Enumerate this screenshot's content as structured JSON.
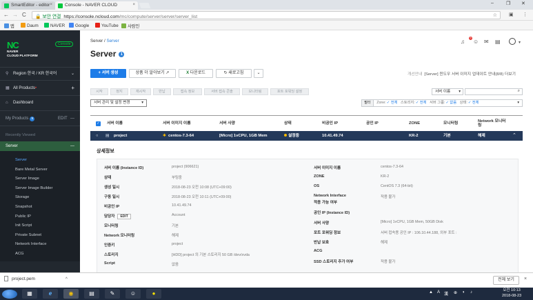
{
  "browser": {
    "tabs": [
      {
        "label": "SmartEditor - editor",
        "close": "×"
      },
      {
        "label": "Console - NAVER CLOUD",
        "close": "×"
      }
    ],
    "window_controls": [
      "–",
      "❐",
      "✕"
    ],
    "nav": {
      "back": "←",
      "forward": "→",
      "reload": "C"
    },
    "address": {
      "lock": "🔒",
      "secure_label": "보안 연결",
      "url_host": "https://console.ncloud.com",
      "url_path": "/mc/compute/server/server/server_list",
      "star": "☆"
    },
    "right_icons": [
      "▣",
      "⋮"
    ],
    "bookmarks": [
      {
        "label": "앱",
        "color": "#4a90e2"
      },
      {
        "label": "Daum",
        "color": "#f39c12"
      },
      {
        "label": "NAVER",
        "color": "#03c75a"
      },
      {
        "label": "Google",
        "color": "#4285f4"
      },
      {
        "label": "YouTube",
        "color": "#e62117"
      },
      {
        "label": "사람인",
        "color": "#7cb342"
      }
    ]
  },
  "sidebar": {
    "logo_mark": "NC",
    "brand_line1": "NAVER",
    "brand_line2": "CLOUD PLATFORM",
    "console_badge": "Console",
    "region": "Region 한국 / KR 한국어",
    "region_arrow": "⌄",
    "all_products": "All Products",
    "all_products_plus": "+",
    "dashboard": "Dashboard",
    "my_products": "My Products",
    "my_products_count": "9",
    "my_products_edit": "EDIT",
    "my_products_minus": "—",
    "recently_viewed": "Recently Viewed",
    "server": "Server",
    "server_minus": "—",
    "items": [
      "Server",
      "Bare Metal Server",
      "Server Image",
      "Server Image Builder",
      "Storage",
      "Snapshot",
      "Public IP",
      "Init Script",
      "Private Subnet",
      "Network Interface",
      "ACG"
    ]
  },
  "main": {
    "breadcrumb": {
      "root": "Server",
      "sep": "/",
      "current": "Server"
    },
    "title": "Server",
    "title_badge": "1",
    "top_icons": [
      "♫",
      "☺",
      "✉",
      "▤",
      "▥",
      "⚙"
    ],
    "notification_count": "9",
    "toolbar": {
      "create": "+ 서버 생성",
      "learn_more": "상품 더 알아보기",
      "learn_more_icon": "↗",
      "download": "다운로드",
      "download_icon": "X",
      "refresh": "새로고침",
      "refresh_icon": "↻",
      "more": "⌄"
    },
    "notice": {
      "label": "개선안내",
      "text": "[Server] 윈도우 서버 이미지 업데이트 안내(8/8)",
      "more": "더보기"
    },
    "action_buttons": [
      "시작",
      "정지",
      "재시작",
      "반납",
      "접속 정보",
      "서버 접속 콘솔",
      "모니터링",
      "포트 포워딩 설정"
    ],
    "search": {
      "select": "서버 이름",
      "select_arrow": "▾",
      "icon": "⌕"
    },
    "mgmt_select": "서버 관리 및 설정 변경",
    "mgmt_arrow": "▾",
    "filter": {
      "label": "필터",
      "parts": [
        {
          "key": "Zone:",
          "value": "✓ 전체"
        },
        {
          "key": "스토리지:",
          "value": "✓ 전체"
        },
        {
          "key": "서버 그룹:",
          "value": "✓ 없음"
        },
        {
          "key": "상태:",
          "value": "✓ 전체"
        }
      ],
      "arrow": "▾"
    },
    "table": {
      "headers": [
        "서버 이름",
        "서버 이미지 이름",
        "서버 사양",
        "상태",
        "비공인 IP",
        "공인 IP",
        "ZONE",
        "모니터링",
        "Network 모니터링"
      ],
      "header_check": "✓",
      "row": {
        "check": "○",
        "name": "project",
        "image": "centos-7.3-64",
        "spec": "[Micro] 1vCPU, 1GB Mem",
        "status": "설정중",
        "private_ip": "10.41.49.74",
        "public_ip": "",
        "zone": "KR-2",
        "monitoring": "기본",
        "network_monitoring": "해제",
        "expand": "⌃"
      }
    },
    "detail": {
      "title": "상세정보",
      "left": [
        {
          "label": "서버 이름 (Instance ID)",
          "value": "project (906621)"
        },
        {
          "label": "상태",
          "value": "부팅중"
        },
        {
          "label": "생성 일시",
          "value": "2018-08-23 오전 10:08 (UTC+09:00)"
        },
        {
          "label": "구동 일시",
          "value": "2018-08-23 오전 10:11 (UTC+09:00)"
        },
        {
          "label": "비공인 IP",
          "value": "10.41.49.74"
        },
        {
          "label": "담당자",
          "value": "Account",
          "edit": "EDIT"
        },
        {
          "label": "모니터링",
          "value": "기본"
        },
        {
          "label": "Network 모니터링",
          "value": "해제"
        },
        {
          "label": "인증키",
          "value": "project"
        },
        {
          "label": "스토리지",
          "value": "[HDD] project 의 기본 스토리지 50 GB /dev/xvda"
        },
        {
          "label": "Script",
          "value": "없음"
        }
      ],
      "right": [
        {
          "label": "서버 이미지 이름",
          "value": "centos-7.3-64"
        },
        {
          "label": "ZONE",
          "value": "KR-2"
        },
        {
          "label": "OS",
          "value": "CentOS 7.3 (64-bit)"
        },
        {
          "label": "Network Interface",
          "label2": "적용 가능 여부",
          "value": "적용 불가"
        },
        {
          "label": "공인 IP (Instance ID)",
          "value": ""
        },
        {
          "label": "서버 사양",
          "value": "[Micro] 1vCPU, 1GB Mem, 50GB Disk"
        },
        {
          "label": "포트 포워딩 정보",
          "value": "서버 접속용 공인 IP : 106.10.44.188, 외부 포트 :"
        },
        {
          "label": "반납 보호",
          "value": "해제"
        },
        {
          "label": "ACG",
          "value": ""
        },
        {
          "label": "SSD 스토리지 추가 여부",
          "value": "적용 불가"
        }
      ]
    }
  },
  "download_bar": {
    "file": "project.pem",
    "arrow": "^",
    "show_all": "전체 보기",
    "close": "×"
  },
  "taskbar": {
    "apps": [
      "▦",
      "e",
      "◉",
      "▤",
      "✎",
      "☺",
      "●"
    ],
    "tray": [
      "▲",
      "A",
      "漢",
      "⊕",
      "◑",
      "♪"
    ],
    "time": "오전 10:13",
    "date": "2018-08-23"
  }
}
